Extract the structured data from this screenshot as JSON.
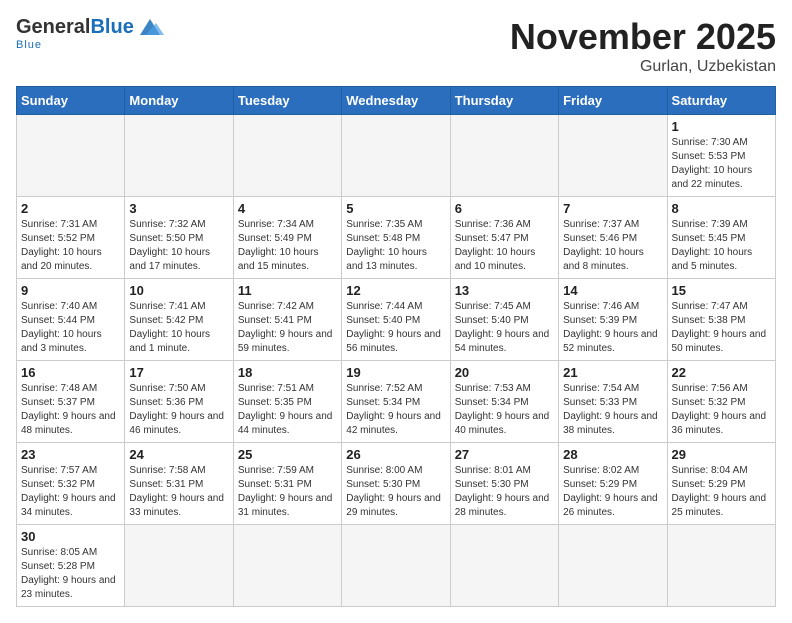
{
  "header": {
    "logo_general": "General",
    "logo_blue": "Blue",
    "logo_tagline": "Blue",
    "month": "November 2025",
    "location": "Gurlan, Uzbekistan"
  },
  "weekdays": [
    "Sunday",
    "Monday",
    "Tuesday",
    "Wednesday",
    "Thursday",
    "Friday",
    "Saturday"
  ],
  "weeks": [
    [
      {
        "day": "",
        "info": ""
      },
      {
        "day": "",
        "info": ""
      },
      {
        "day": "",
        "info": ""
      },
      {
        "day": "",
        "info": ""
      },
      {
        "day": "",
        "info": ""
      },
      {
        "day": "",
        "info": ""
      },
      {
        "day": "1",
        "info": "Sunrise: 7:30 AM\nSunset: 5:53 PM\nDaylight: 10 hours\nand 22 minutes."
      }
    ],
    [
      {
        "day": "2",
        "info": "Sunrise: 7:31 AM\nSunset: 5:52 PM\nDaylight: 10 hours\nand 20 minutes."
      },
      {
        "day": "3",
        "info": "Sunrise: 7:32 AM\nSunset: 5:50 PM\nDaylight: 10 hours\nand 17 minutes."
      },
      {
        "day": "4",
        "info": "Sunrise: 7:34 AM\nSunset: 5:49 PM\nDaylight: 10 hours\nand 15 minutes."
      },
      {
        "day": "5",
        "info": "Sunrise: 7:35 AM\nSunset: 5:48 PM\nDaylight: 10 hours\nand 13 minutes."
      },
      {
        "day": "6",
        "info": "Sunrise: 7:36 AM\nSunset: 5:47 PM\nDaylight: 10 hours\nand 10 minutes."
      },
      {
        "day": "7",
        "info": "Sunrise: 7:37 AM\nSunset: 5:46 PM\nDaylight: 10 hours\nand 8 minutes."
      },
      {
        "day": "8",
        "info": "Sunrise: 7:39 AM\nSunset: 5:45 PM\nDaylight: 10 hours\nand 5 minutes."
      }
    ],
    [
      {
        "day": "9",
        "info": "Sunrise: 7:40 AM\nSunset: 5:44 PM\nDaylight: 10 hours\nand 3 minutes."
      },
      {
        "day": "10",
        "info": "Sunrise: 7:41 AM\nSunset: 5:42 PM\nDaylight: 10 hours\nand 1 minute."
      },
      {
        "day": "11",
        "info": "Sunrise: 7:42 AM\nSunset: 5:41 PM\nDaylight: 9 hours\nand 59 minutes."
      },
      {
        "day": "12",
        "info": "Sunrise: 7:44 AM\nSunset: 5:40 PM\nDaylight: 9 hours\nand 56 minutes."
      },
      {
        "day": "13",
        "info": "Sunrise: 7:45 AM\nSunset: 5:40 PM\nDaylight: 9 hours\nand 54 minutes."
      },
      {
        "day": "14",
        "info": "Sunrise: 7:46 AM\nSunset: 5:39 PM\nDaylight: 9 hours\nand 52 minutes."
      },
      {
        "day": "15",
        "info": "Sunrise: 7:47 AM\nSunset: 5:38 PM\nDaylight: 9 hours\nand 50 minutes."
      }
    ],
    [
      {
        "day": "16",
        "info": "Sunrise: 7:48 AM\nSunset: 5:37 PM\nDaylight: 9 hours\nand 48 minutes."
      },
      {
        "day": "17",
        "info": "Sunrise: 7:50 AM\nSunset: 5:36 PM\nDaylight: 9 hours\nand 46 minutes."
      },
      {
        "day": "18",
        "info": "Sunrise: 7:51 AM\nSunset: 5:35 PM\nDaylight: 9 hours\nand 44 minutes."
      },
      {
        "day": "19",
        "info": "Sunrise: 7:52 AM\nSunset: 5:34 PM\nDaylight: 9 hours\nand 42 minutes."
      },
      {
        "day": "20",
        "info": "Sunrise: 7:53 AM\nSunset: 5:34 PM\nDaylight: 9 hours\nand 40 minutes."
      },
      {
        "day": "21",
        "info": "Sunrise: 7:54 AM\nSunset: 5:33 PM\nDaylight: 9 hours\nand 38 minutes."
      },
      {
        "day": "22",
        "info": "Sunrise: 7:56 AM\nSunset: 5:32 PM\nDaylight: 9 hours\nand 36 minutes."
      }
    ],
    [
      {
        "day": "23",
        "info": "Sunrise: 7:57 AM\nSunset: 5:32 PM\nDaylight: 9 hours\nand 34 minutes."
      },
      {
        "day": "24",
        "info": "Sunrise: 7:58 AM\nSunset: 5:31 PM\nDaylight: 9 hours\nand 33 minutes."
      },
      {
        "day": "25",
        "info": "Sunrise: 7:59 AM\nSunset: 5:31 PM\nDaylight: 9 hours\nand 31 minutes."
      },
      {
        "day": "26",
        "info": "Sunrise: 8:00 AM\nSunset: 5:30 PM\nDaylight: 9 hours\nand 29 minutes."
      },
      {
        "day": "27",
        "info": "Sunrise: 8:01 AM\nSunset: 5:30 PM\nDaylight: 9 hours\nand 28 minutes."
      },
      {
        "day": "28",
        "info": "Sunrise: 8:02 AM\nSunset: 5:29 PM\nDaylight: 9 hours\nand 26 minutes."
      },
      {
        "day": "29",
        "info": "Sunrise: 8:04 AM\nSunset: 5:29 PM\nDaylight: 9 hours\nand 25 minutes."
      }
    ],
    [
      {
        "day": "30",
        "info": "Sunrise: 8:05 AM\nSunset: 5:28 PM\nDaylight: 9 hours\nand 23 minutes."
      },
      {
        "day": "",
        "info": ""
      },
      {
        "day": "",
        "info": ""
      },
      {
        "day": "",
        "info": ""
      },
      {
        "day": "",
        "info": ""
      },
      {
        "day": "",
        "info": ""
      },
      {
        "day": "",
        "info": ""
      }
    ]
  ]
}
